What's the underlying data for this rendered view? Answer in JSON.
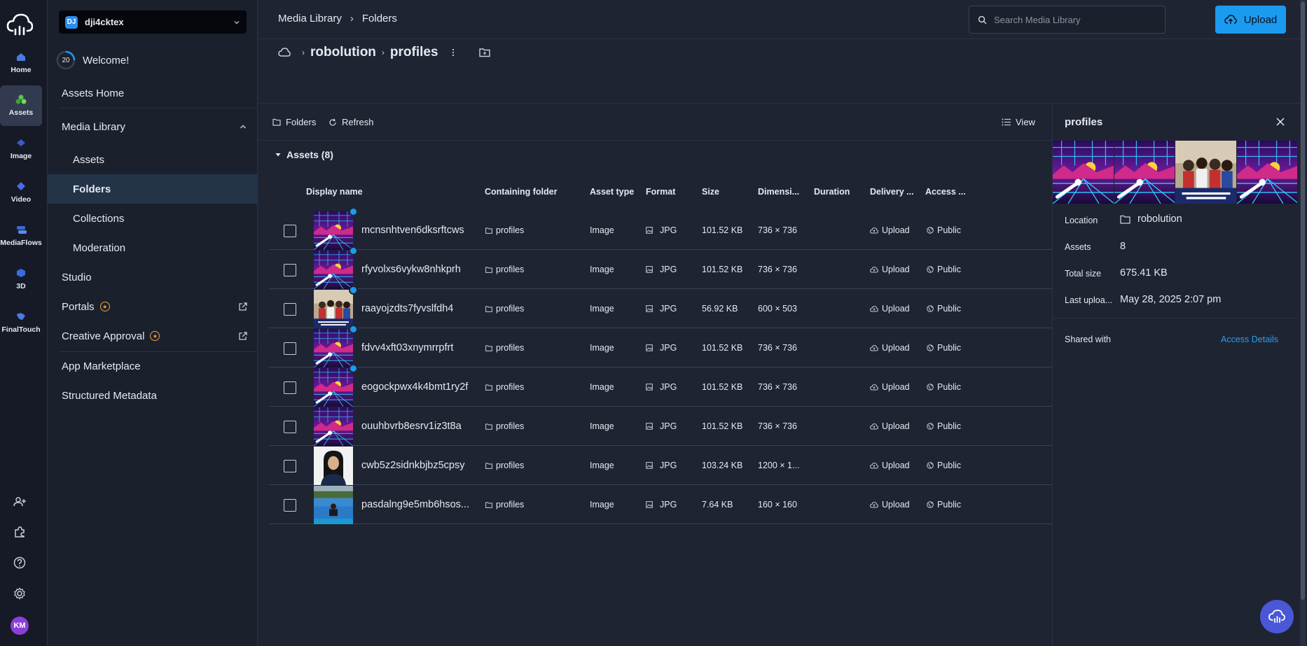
{
  "rail": {
    "items": [
      {
        "label": "Home",
        "icon": "home-icon"
      },
      {
        "label": "Assets",
        "icon": "assets-icon"
      },
      {
        "label": "Image",
        "icon": "image-icon"
      },
      {
        "label": "Video",
        "icon": "video-icon"
      },
      {
        "label": "MediaFlows",
        "icon": "mediaflows-icon"
      },
      {
        "label": "3D",
        "icon": "cube-icon"
      },
      {
        "label": "FinalTouch",
        "icon": "finaltouch-icon"
      }
    ],
    "avatar_initials": "KM",
    "accent_color": "#1a9bf0"
  },
  "sidebar": {
    "workspace_badge": "DJ",
    "workspace_name": "dji4cktex",
    "progress_value": "20",
    "welcome": "Welcome!",
    "items": {
      "assets_home": "Assets Home",
      "media_library": "Media Library",
      "assets": "Assets",
      "folders": "Folders",
      "collections": "Collections",
      "moderation": "Moderation",
      "studio": "Studio",
      "portals": "Portals",
      "creative_approval": "Creative Approval",
      "app_marketplace": "App Marketplace",
      "structured_metadata": "Structured Metadata"
    }
  },
  "topbar": {
    "breadcrumb": [
      "Media Library",
      "Folders"
    ],
    "search_placeholder": "Search Media Library",
    "upload_label": "Upload"
  },
  "folder": {
    "parent": "robolution",
    "name": "profiles"
  },
  "toolbar": {
    "folders": "Folders",
    "refresh": "Refresh",
    "view": "View"
  },
  "group": {
    "label": "Assets (8)"
  },
  "table": {
    "columns": [
      "Display name",
      "Containing folder",
      "Asset type",
      "Format",
      "Size",
      "Dimensi...",
      "Duration",
      "Delivery ...",
      "Access ..."
    ],
    "rows": [
      {
        "name": "mcnsnhtven6dksrftcws",
        "folder": "profiles",
        "type": "Image",
        "format": "JPG",
        "size": "101.52 KB",
        "dims": "736 × 736",
        "delivery": "Upload",
        "access": "Public",
        "thumb": "synth",
        "dot": true
      },
      {
        "name": "rfyvolxs6vykw8nhkprh",
        "folder": "profiles",
        "type": "Image",
        "format": "JPG",
        "size": "101.52 KB",
        "dims": "736 × 736",
        "delivery": "Upload",
        "access": "Public",
        "thumb": "synth",
        "dot": true
      },
      {
        "name": "raayojzdts7fyvslfdh4",
        "folder": "profiles",
        "type": "Image",
        "format": "JPG",
        "size": "56.92 KB",
        "dims": "600 × 503",
        "delivery": "Upload",
        "access": "Public",
        "thumb": "group",
        "dot": true
      },
      {
        "name": "fdvv4xft03xnymrrpfrt",
        "folder": "profiles",
        "type": "Image",
        "format": "JPG",
        "size": "101.52 KB",
        "dims": "736 × 736",
        "delivery": "Upload",
        "access": "Public",
        "thumb": "synth",
        "dot": true
      },
      {
        "name": "eogockpwx4k4bmt1ry2f",
        "folder": "profiles",
        "type": "Image",
        "format": "JPG",
        "size": "101.52 KB",
        "dims": "736 × 736",
        "delivery": "Upload",
        "access": "Public",
        "thumb": "synth",
        "dot": true
      },
      {
        "name": "ouuhbvrb8esrv1iz3t8a",
        "folder": "profiles",
        "type": "Image",
        "format": "JPG",
        "size": "101.52 KB",
        "dims": "736 × 736",
        "delivery": "Upload",
        "access": "Public",
        "thumb": "synth",
        "dot": false
      },
      {
        "name": "cwb5z2sidnkbjbz5cpsy",
        "folder": "profiles",
        "type": "Image",
        "format": "JPG",
        "size": "103.24 KB",
        "dims": "1200 × 1...",
        "delivery": "Upload",
        "access": "Public",
        "thumb": "portrait",
        "dot": false
      },
      {
        "name": "pasdalng9e5mb6hsos...",
        "folder": "profiles",
        "type": "Image",
        "format": "JPG",
        "size": "7.64 KB",
        "dims": "160 × 160",
        "delivery": "Upload",
        "access": "Public",
        "thumb": "pool",
        "dot": false
      }
    ]
  },
  "panel": {
    "title": "profiles",
    "location_label": "Location",
    "location_value": "robolution",
    "assets_label": "Assets",
    "assets_value": "8",
    "total_size_label": "Total size",
    "total_size_value": "675.41 KB",
    "last_upload_label": "Last uploa...",
    "last_upload_value": "May 28, 2025 2:07 pm",
    "shared_with": "Shared with",
    "access_details": "Access Details"
  }
}
